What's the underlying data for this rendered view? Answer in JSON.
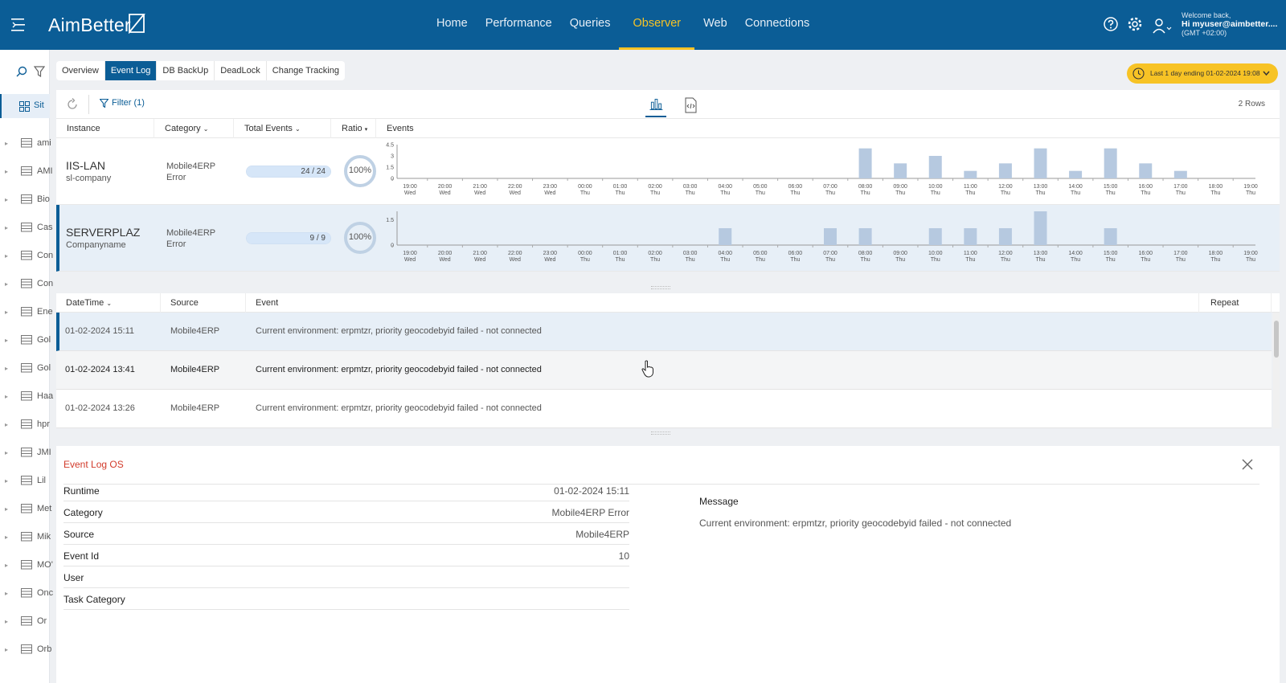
{
  "app": {
    "logo": "AimBetter",
    "brand_color": "#0b5d96",
    "accent_color": "#f7c325"
  },
  "nav": {
    "items": [
      {
        "label": "Home"
      },
      {
        "label": "Performance"
      },
      {
        "label": "Queries"
      },
      {
        "label": "Observer",
        "active": true
      },
      {
        "label": "Web"
      },
      {
        "label": "Connections"
      }
    ]
  },
  "user": {
    "welcome": "Welcome back,",
    "greeting": "Hi myuser@aimbetter....",
    "timezone": "(GMT +02:00)"
  },
  "rail": {
    "selected": "Sit",
    "items": [
      "ami",
      "AMI",
      "Bio",
      "Cas",
      "Con",
      "Con",
      "Ene",
      "Gol",
      "Gol",
      "Haa",
      "hpr",
      "JMI",
      "Lil",
      "Met",
      "Mik",
      "MO'",
      "Onc",
      "Or",
      "Orb"
    ]
  },
  "subtabs": [
    {
      "label": "Overview"
    },
    {
      "label": "Event Log",
      "active": true
    },
    {
      "label": "DB BackUp"
    },
    {
      "label": "DeadLock"
    },
    {
      "label": "Change Tracking"
    }
  ],
  "date_range": {
    "label": "Last 1 day ending  01-02-2024 19:08"
  },
  "toolbar": {
    "filter_label": "Filter (1)",
    "rows_label": "2 Rows"
  },
  "instance_columns": {
    "instance": "Instance",
    "category": "Category",
    "total_events": "Total Events",
    "ratio": "Ratio",
    "events": "Events"
  },
  "instances": [
    {
      "name": "IIS-LAN",
      "sub": "sl-company",
      "category_line1": "Mobile4ERP",
      "category_line2": "Error",
      "events_text": "24 / 24",
      "events_fraction": 1.0,
      "ratio_text": "100%",
      "selected": false
    },
    {
      "name": "SERVERPLAZ",
      "sub": "Companyname",
      "category_line1": "Mobile4ERP",
      "category_line2": "Error",
      "events_text": "9 / 9",
      "events_fraction": 1.0,
      "ratio_text": "100%",
      "selected": true
    }
  ],
  "chart_data": [
    {
      "type": "bar",
      "categories": [
        "19:00 Wed",
        "20:00 Wed",
        "21:00 Wed",
        "22:00 Wed",
        "23:00 Wed",
        "00:00 Thu",
        "01:00 Thu",
        "02:00 Thu",
        "03:00 Thu",
        "04:00 Thu",
        "05:00 Thu",
        "06:00 Thu",
        "07:00 Thu",
        "08:00 Thu",
        "09:00 Thu",
        "10:00 Thu",
        "11:00 Thu",
        "12:00 Thu",
        "13:00 Thu",
        "14:00 Thu",
        "15:00 Thu",
        "16:00 Thu",
        "17:00 Thu",
        "18:00 Thu",
        "19:00 Thu"
      ],
      "values": [
        0,
        0,
        0,
        0,
        0,
        0,
        0,
        0,
        0,
        0,
        0,
        0,
        0,
        4,
        2,
        3,
        1,
        2,
        4,
        1,
        4,
        2,
        1,
        0,
        0
      ],
      "yticks": [
        "4.5",
        "3",
        "1.5",
        "0"
      ],
      "ylim": [
        0,
        4.5
      ]
    },
    {
      "type": "bar",
      "categories": [
        "19:00 Wed",
        "20:00 Wed",
        "21:00 Wed",
        "22:00 Wed",
        "23:00 Wed",
        "00:00 Thu",
        "01:00 Thu",
        "02:00 Thu",
        "03:00 Thu",
        "04:00 Thu",
        "05:00 Thu",
        "06:00 Thu",
        "07:00 Thu",
        "08:00 Thu",
        "09:00 Thu",
        "10:00 Thu",
        "11:00 Thu",
        "12:00 Thu",
        "13:00 Thu",
        "14:00 Thu",
        "15:00 Thu",
        "16:00 Thu",
        "17:00 Thu",
        "18:00 Thu",
        "19:00 Thu"
      ],
      "values": [
        0,
        0,
        0,
        0,
        0,
        0,
        0,
        0,
        0,
        1,
        0,
        0,
        1,
        1,
        0,
        1,
        1,
        1,
        2,
        0,
        1,
        0,
        0,
        0,
        0
      ],
      "yticks": [
        "1.5",
        "0"
      ],
      "ylim": [
        0,
        2
      ]
    }
  ],
  "event_columns": {
    "datetime": "DateTime",
    "source": "Source",
    "event": "Event",
    "repeat": "Repeat"
  },
  "events": [
    {
      "datetime": "01-02-2024 15:11",
      "source": "Mobile4ERP",
      "event": "Current environment: erpmtzr, priority geocodebyid failed - not connected"
    },
    {
      "datetime": "01-02-2024 13:41",
      "source": "Mobile4ERP",
      "event": "Current environment: erpmtzr, priority geocodebyid failed - not connected"
    },
    {
      "datetime": "01-02-2024 13:26",
      "source": "Mobile4ERP",
      "event": "Current environment: erpmtzr, priority geocodebyid failed - not connected"
    }
  ],
  "detail": {
    "title": "Event Log OS",
    "fields": [
      {
        "key": "Runtime",
        "value": "01-02-2024 15:11"
      },
      {
        "key": "Category",
        "value": "Mobile4ERP Error"
      },
      {
        "key": "Source",
        "value": "Mobile4ERP"
      },
      {
        "key": "Event Id",
        "value": "10"
      },
      {
        "key": "User",
        "value": ""
      },
      {
        "key": "Task Category",
        "value": ""
      }
    ],
    "message_label": "Message",
    "message": "Current environment: erpmtzr, priority geocodebyid failed - not connected"
  }
}
